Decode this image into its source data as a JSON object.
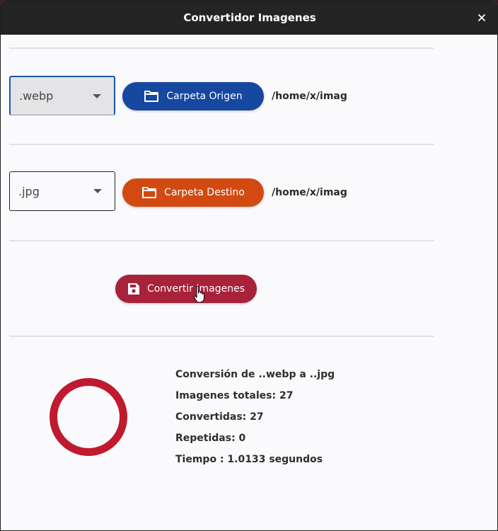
{
  "window": {
    "title": "Convertidor Imagenes",
    "close_icon": "close-icon"
  },
  "source": {
    "format_selected": ".webp",
    "folder_button_label": "Carpeta Origen",
    "folder_icon": "folder-icon",
    "path": "/home/x/imag",
    "button_color": "#1648a0"
  },
  "destination": {
    "format_selected": ".jpg",
    "folder_button_label": "Carpeta Destino",
    "folder_icon": "folder-icon",
    "path": "/home/x/imag",
    "button_color": "#d24a12"
  },
  "convert": {
    "button_label": "Convertir Imagenes",
    "icon": "save-icon",
    "button_color": "#a8223a"
  },
  "progress": {
    "ring_color": "#c01a30"
  },
  "stats": {
    "conversion": "Conversión de ..webp a ..jpg",
    "total": "Imagenes totales: 27",
    "converted": "Convertidas: 27",
    "repeated": "Repetidas: 0",
    "time": "Tiempo : 1.0133 segundos"
  }
}
